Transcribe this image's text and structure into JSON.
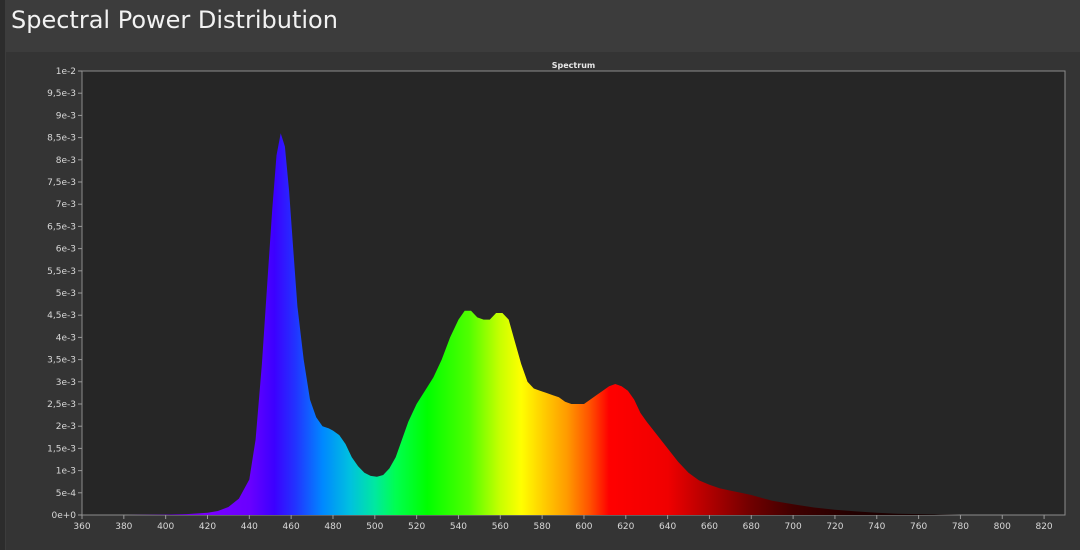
{
  "header": {
    "title": "Spectral Power Distribution"
  },
  "chart_data": {
    "type": "area",
    "title": "Spectrum",
    "xlabel": "",
    "ylabel": "",
    "xlim": [
      360,
      830
    ],
    "ylim": [
      0,
      0.01
    ],
    "grid": false,
    "legend": "none",
    "x_ticks": [
      360,
      380,
      400,
      420,
      440,
      460,
      480,
      500,
      520,
      540,
      560,
      580,
      600,
      620,
      640,
      660,
      680,
      700,
      720,
      740,
      760,
      780,
      800,
      820
    ],
    "x_tick_labels": [
      "360",
      "380",
      "400",
      "420",
      "440",
      "460",
      "480",
      "500",
      "520",
      "540",
      "560",
      "580",
      "600",
      "620",
      "640",
      "660",
      "680",
      "700",
      "720",
      "740",
      "760",
      "780",
      "800",
      "820"
    ],
    "y_ticks": [
      0,
      0.0005,
      0.001,
      0.0015,
      0.002,
      0.0025,
      0.003,
      0.0035,
      0.004,
      0.0045,
      0.005,
      0.0055,
      0.006,
      0.0065,
      0.007,
      0.0075,
      0.008,
      0.0085,
      0.009,
      0.0095,
      0.01
    ],
    "y_tick_labels": [
      "0e+0",
      "5e-4",
      "1e-3",
      "1,5e-3",
      "2e-3",
      "2,5e-3",
      "3e-3",
      "3,5e-3",
      "4e-3",
      "4,5e-3",
      "5e-3",
      "5,5e-3",
      "6e-3",
      "6,5e-3",
      "7e-3",
      "7,5e-3",
      "8e-3",
      "8,5e-3",
      "9e-3",
      "9,5e-3",
      "1e-2"
    ],
    "series": [
      {
        "fill": "wavelength-rainbow",
        "x": [
          380,
          400,
          410,
          420,
          425,
          430,
          435,
          440,
          443,
          446,
          449,
          451,
          453,
          455,
          457,
          459,
          461,
          463,
          466,
          469,
          472,
          475,
          478,
          480,
          483,
          486,
          489,
          492,
          495,
          498,
          501,
          504,
          507,
          510,
          513,
          516,
          520,
          524,
          528,
          532,
          536,
          540,
          543,
          546,
          549,
          552,
          555,
          558,
          561,
          564,
          567,
          570,
          573,
          576,
          579,
          582,
          585,
          588,
          591,
          594,
          597,
          600,
          603,
          606,
          609,
          612,
          615,
          618,
          621,
          624,
          627,
          630,
          635,
          640,
          645,
          650,
          655,
          660,
          665,
          670,
          675,
          680,
          690,
          700,
          710,
          720,
          730,
          740,
          750,
          760,
          770,
          780
        ],
        "y": [
          0.0,
          1e-05,
          2e-05,
          5e-05,
          9e-05,
          0.00018,
          0.00037,
          0.0008,
          0.0017,
          0.0034,
          0.0055,
          0.0069,
          0.0081,
          0.0086,
          0.0083,
          0.0073,
          0.006,
          0.0047,
          0.0035,
          0.0026,
          0.0022,
          0.002,
          0.00195,
          0.0019,
          0.0018,
          0.0016,
          0.0013,
          0.0011,
          0.00095,
          0.00088,
          0.00086,
          0.0009,
          0.00105,
          0.0013,
          0.0017,
          0.0021,
          0.0025,
          0.0028,
          0.0031,
          0.0035,
          0.004,
          0.0044,
          0.0046,
          0.0046,
          0.00445,
          0.0044,
          0.0044,
          0.00455,
          0.00455,
          0.0044,
          0.0039,
          0.0034,
          0.003,
          0.00285,
          0.0028,
          0.00275,
          0.0027,
          0.00265,
          0.00255,
          0.0025,
          0.0025,
          0.0025,
          0.0026,
          0.0027,
          0.0028,
          0.0029,
          0.00295,
          0.0029,
          0.0028,
          0.0026,
          0.0023,
          0.0021,
          0.0018,
          0.0015,
          0.0012,
          0.00095,
          0.00078,
          0.00068,
          0.0006,
          0.00055,
          0.0005,
          0.00045,
          0.00032,
          0.00024,
          0.00017,
          0.00012,
          8e-05,
          5e-05,
          3e-05,
          2e-05,
          1e-05,
          0.0
        ]
      }
    ]
  }
}
